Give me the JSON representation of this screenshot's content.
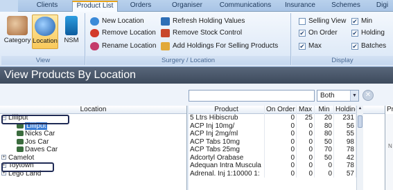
{
  "ribbon_tabs": [
    "Clients",
    "Product List",
    "Orders",
    "Organiser",
    "Communications",
    "Insurance",
    "Schemes",
    "Digi"
  ],
  "view_group": {
    "label": "View",
    "buttons": [
      "Category",
      "Location",
      "NSM"
    ]
  },
  "surgery_group": {
    "label": "Surgery / Location",
    "buttons": [
      "New Location",
      "Remove Location",
      "Rename Location",
      "Refresh Holding Values",
      "Remove Stock Control",
      "Add Holdings For Selling Products"
    ]
  },
  "display_group": {
    "label": "Display",
    "checkboxes": [
      {
        "label": "Selling View",
        "checked": false
      },
      {
        "label": "On Order",
        "checked": true
      },
      {
        "label": "Max",
        "checked": true
      },
      {
        "label": "Min",
        "checked": true
      },
      {
        "label": "Holding",
        "checked": true
      },
      {
        "label": "Batches",
        "checked": true
      }
    ]
  },
  "page_title": "View Products By Location",
  "filter": {
    "search_value": "",
    "combo_value": "Both"
  },
  "tree": {
    "header": "Location",
    "rows": [
      {
        "label": "Lilliput",
        "level": 0,
        "expander": "-"
      },
      {
        "label": "Lilliput",
        "level": 1,
        "selected": true
      },
      {
        "label": "Nicks Car",
        "level": 1
      },
      {
        "label": "Jos Car",
        "level": 1
      },
      {
        "label": "Daves Car",
        "level": 1
      },
      {
        "label": "Camelot",
        "level": 0,
        "expander": "+"
      },
      {
        "label": "Toytown",
        "level": 0,
        "expander": "+"
      },
      {
        "label": "Lego Land",
        "level": 0,
        "expander": "+"
      }
    ]
  },
  "grid": {
    "columns": [
      "Product",
      "On Order",
      "Max",
      "Min",
      "Holding"
    ],
    "rows": [
      [
        "5 Ltrs Hibiscrub",
        "0",
        "25",
        "20",
        "231"
      ],
      [
        "ACP Inj 10mg/",
        "0",
        "0",
        "80",
        "56"
      ],
      [
        "ACP Inj 2mg/ml",
        "0",
        "0",
        "80",
        "55"
      ],
      [
        "ACP Tabs 10mg",
        "0",
        "0",
        "50",
        "98"
      ],
      [
        "ACP Tabs 25mg",
        "0",
        "0",
        "70",
        "78"
      ],
      [
        "Adcortyl Orabase",
        "0",
        "0",
        "50",
        "42"
      ],
      [
        "Adequan Intra Muscula",
        "0",
        "0",
        "0",
        "78"
      ],
      [
        "Adrenal. Inj 1:10000 1:",
        "0",
        "0",
        "0",
        "57"
      ]
    ]
  },
  "price_panel": {
    "tab": "Pric",
    "letter": "N"
  }
}
